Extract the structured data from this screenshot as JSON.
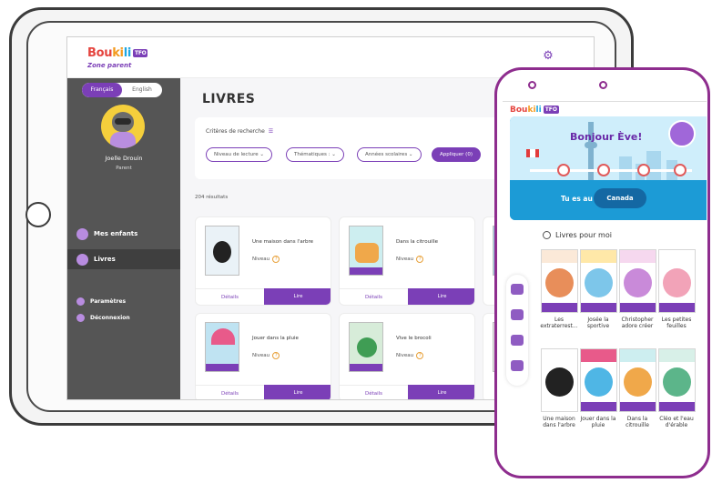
{
  "tablet": {
    "brand": {
      "part1": "Bou",
      "part2": "ki",
      "part3": "li",
      "badge": "TFO",
      "subtitle": "Zone parent"
    },
    "language": {
      "selected": "Français",
      "other": "English"
    },
    "user": {
      "name": "Joelle Drouin",
      "role": "Parent"
    },
    "sidebar": {
      "items": [
        {
          "label": "Mes enfants"
        },
        {
          "label": "Livres"
        },
        {
          "label": "Paramètres"
        },
        {
          "label": "Déconnexion"
        }
      ]
    },
    "main": {
      "title": "LIVRES",
      "criteria_label": "Critères de recherche",
      "filters": [
        "Niveau de lecture ⌄",
        "Thématiques : ⌄",
        "Années scolaires ⌄"
      ],
      "apply_label": "Appliquer (0)",
      "results": "204 résultats",
      "books": [
        {
          "title": "Une maison dans l'arbre",
          "niveau": "Niveau",
          "details": "Détails",
          "read": "Lire"
        },
        {
          "title": "Dans la citrouille",
          "niveau": "Niveau",
          "details": "Détails",
          "read": "Lire"
        },
        {
          "title": "Jouer dans la pluie",
          "niveau": "Niveau",
          "details": "Détails",
          "read": "Lire"
        },
        {
          "title": "Vive le brocoli",
          "niveau": "Niveau",
          "details": "Détails",
          "read": "Lire"
        }
      ]
    }
  },
  "phone": {
    "greeting": "Bonjour Ève!",
    "tues_prefix": "Tu es au",
    "location": "Canada",
    "section_title": "Livres pour moi",
    "books_row1": [
      "Les extraterrest...",
      "Josée la sportive",
      "Christopher adore créer",
      "Les petites feuilles"
    ],
    "books_row2": [
      "Une maison dans l'arbre",
      "Jouer dans la pluie",
      "Dans la citrouille",
      "Cléo et l'eau d'érable"
    ]
  },
  "colors": {
    "accent": "#7b3fb7",
    "phone_frame": "#8e2d8e",
    "hero_blue": "#2ea9e3",
    "sidebar": "#555555"
  }
}
